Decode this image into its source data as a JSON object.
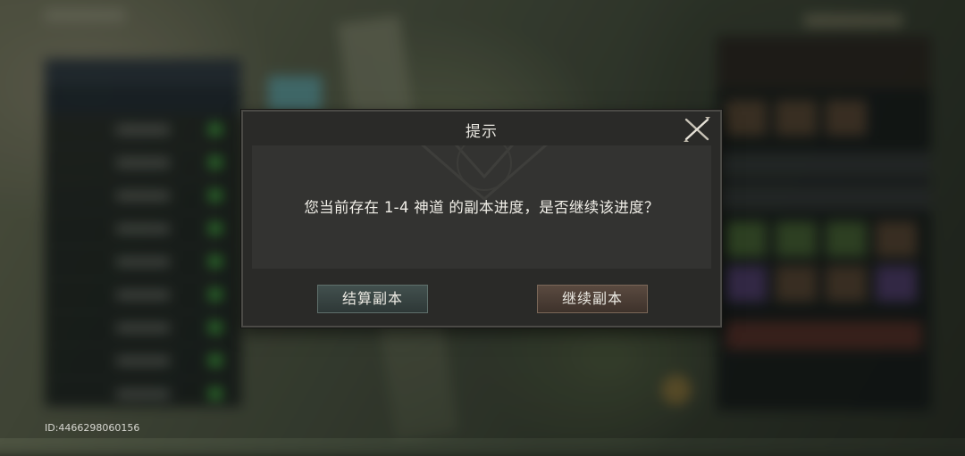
{
  "dialog": {
    "title": "提示",
    "message": "您当前存在 1-4 神道 的副本进度，是否继续该进度？",
    "settle_button": "结算副本",
    "continue_button": "继续副本",
    "close_icon": "close-icon"
  },
  "footer": {
    "player_id": "ID:4466298060156"
  },
  "colors": {
    "dialog_bg": "#2a2a28",
    "settle_button": "#3a4645",
    "continue_button": "#4e4037",
    "text": "#f1efe8"
  }
}
